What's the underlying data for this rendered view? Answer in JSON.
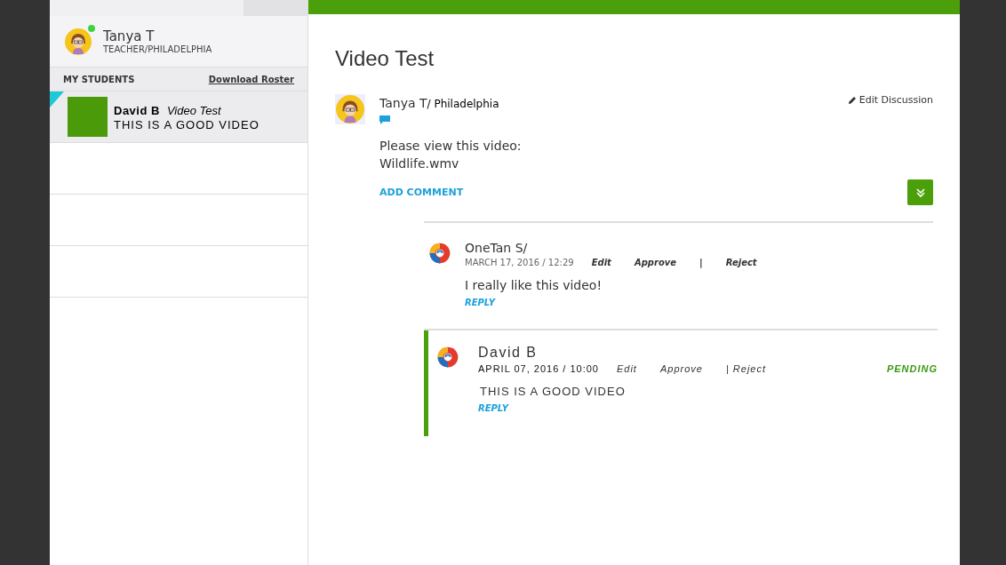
{
  "profile": {
    "name": "Tanya T",
    "role": "TEACHER/PHILADELPHIA",
    "online": true
  },
  "students_header": {
    "title": "MY STUDENTS",
    "link": "Download Roster"
  },
  "students": [
    {
      "name": "David B",
      "topic": "Video Test",
      "message": "THIS IS A GOOD VIDEO",
      "selected": true
    }
  ],
  "discussion": {
    "title": "Video Test",
    "author": "Tanya T",
    "location": "/ Philadelphia",
    "edit_label": "Edit Discussion",
    "body": [
      "Please view this video:",
      "Wildlife.wmv"
    ],
    "add_comment": "ADD COMMENT"
  },
  "comments": [
    {
      "author": "OneTan S/",
      "date": "MARCH 17, 2016 / 12:29",
      "actions": [
        "Edit",
        "Approve",
        "|",
        "Reject"
      ],
      "text": "I really like this video!",
      "reply": "REPLY",
      "highlighted": false
    },
    {
      "author": "David B",
      "date": "APRIL 07, 2016 / 10:00",
      "actions": [
        "Edit",
        "Approve",
        "| Reject"
      ],
      "status": "PENDING",
      "text": "THIS IS A GOOD VIDEO",
      "reply": "REPLY",
      "highlighted": true
    }
  ]
}
